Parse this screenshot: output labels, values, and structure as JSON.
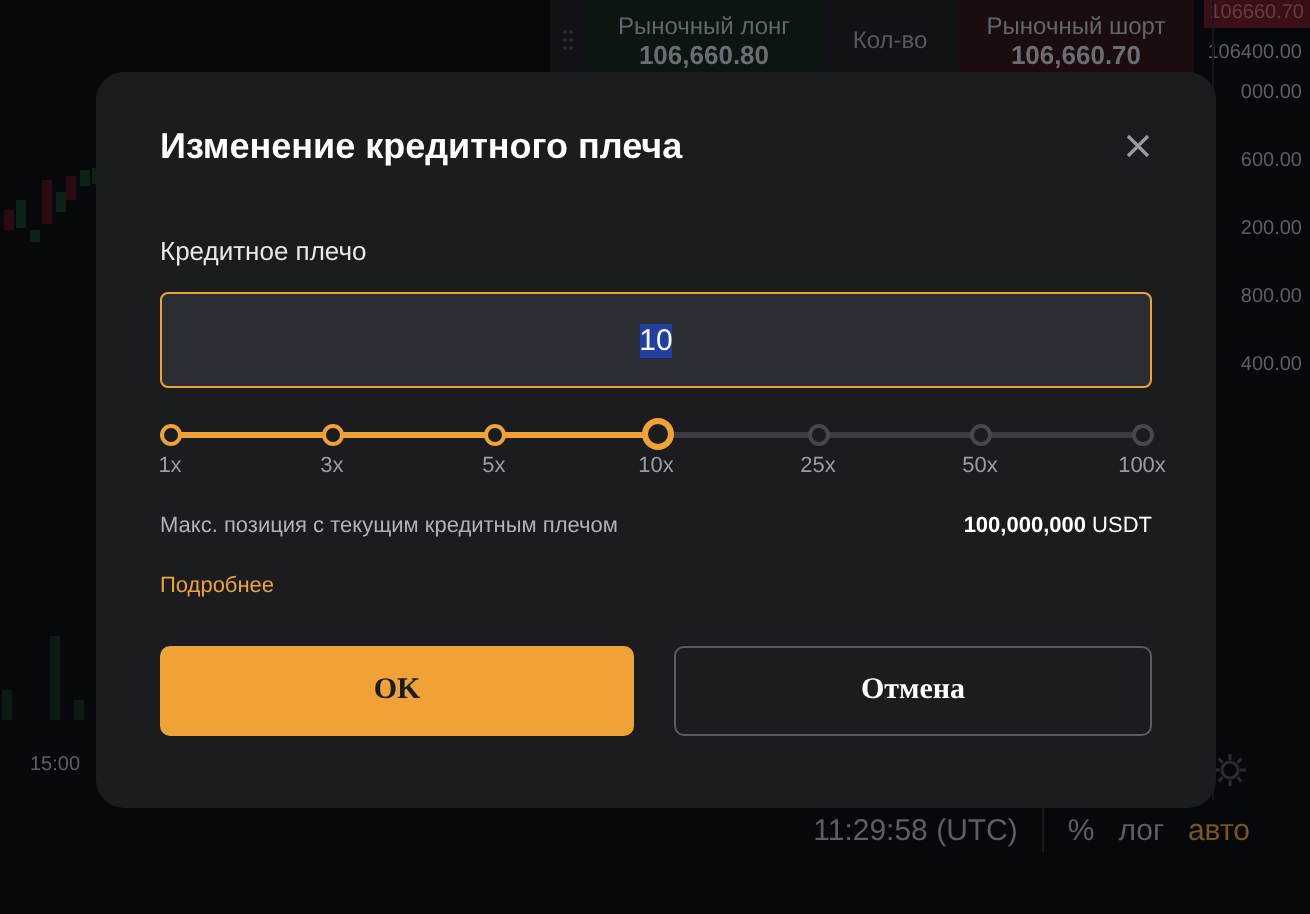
{
  "order_panel": {
    "long": {
      "label": "Рыночный лонг",
      "price": "106,660.80"
    },
    "quantity": "Кол-во",
    "short": {
      "label": "Рыночный шорт",
      "price": "106,660.70"
    }
  },
  "price_axis": [
    {
      "label": "106660.70",
      "kind": "current"
    },
    {
      "label": "106400.00",
      "kind": "tick"
    },
    {
      "label": "000.00",
      "kind": "tick"
    },
    {
      "label": "600.00",
      "kind": "tick"
    },
    {
      "label": "200.00",
      "kind": "tick"
    },
    {
      "label": "800.00",
      "kind": "tick"
    },
    {
      "label": "400.00",
      "kind": "tick"
    }
  ],
  "time_axis": [
    "15:00"
  ],
  "status_bar": {
    "time": "11:29:58 (UTC)",
    "options": [
      {
        "label": "%",
        "selected": false
      },
      {
        "label": "лог",
        "selected": false
      },
      {
        "label": "авто",
        "selected": true
      }
    ]
  },
  "dialog": {
    "title": "Изменение кредитного плеча",
    "field_label": "Кредитное плечо",
    "field": {
      "value": "10",
      "selected": true
    },
    "slider": {
      "level": 0.5,
      "marks": [
        "1x",
        "3x",
        "5x",
        "10x",
        "25x",
        "50x",
        "100x"
      ]
    },
    "info": {
      "label": "Макс. позиция с текущим кредитным плечом",
      "amount": "100,000,000",
      "unit": "USDT"
    },
    "link": "Подробнее",
    "buttons": [
      {
        "label": "OK",
        "kind": "primary"
      },
      {
        "label": "Отмена",
        "kind": "secondary"
      }
    ]
  }
}
